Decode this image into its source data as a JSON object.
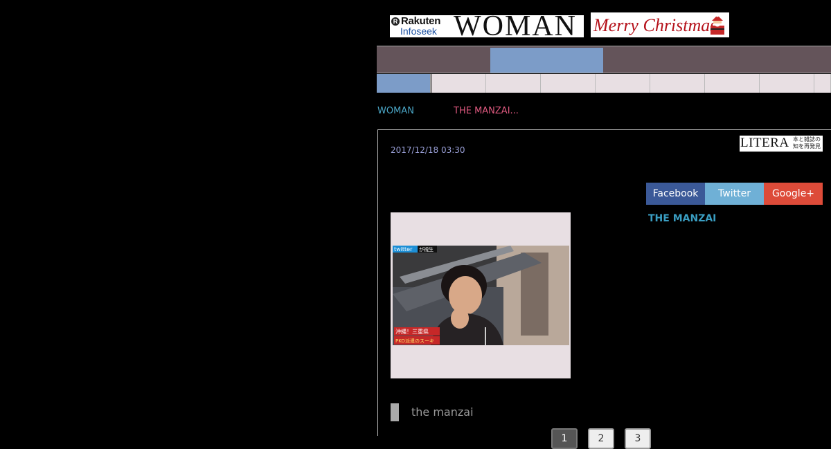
{
  "header": {
    "logo_rakuten": "Rakuten",
    "logo_infoseek": "Infoseek",
    "logo_woman": "WOMAN",
    "banner_text": "Merry Christmas"
  },
  "nav": {
    "top_tabs_count": 4,
    "active_top_index": 1,
    "sub_tabs_count": 9,
    "active_sub_index": 0
  },
  "breadcrumb": {
    "home": "WOMAN",
    "current": "THE MANZAI..."
  },
  "article": {
    "date": "2017/12/18 03:30",
    "source_logo": "LITERA",
    "source_tagline": "本と雑誌の知を再発見",
    "share": {
      "facebook": "Facebook",
      "twitter": "Twitter",
      "googleplus": "Google+"
    },
    "tag": "THE MANZAI",
    "photo_overlay": {
      "badge": "twitter",
      "badge2": "が視生",
      "bottom_line1": "沖縄！三重県",
      "bottom_line2": "PKO派遣のスーキ"
    },
    "caption": "the manzai"
  },
  "pagination": [
    "1",
    "2",
    "3"
  ],
  "colors": {
    "nav_bg": "#64545a",
    "nav_active": "#7c9cc8",
    "facebook": "#3b5998",
    "twitter": "#6fb0d6",
    "googleplus": "#dd4b39",
    "tag": "#3a9ec2"
  }
}
